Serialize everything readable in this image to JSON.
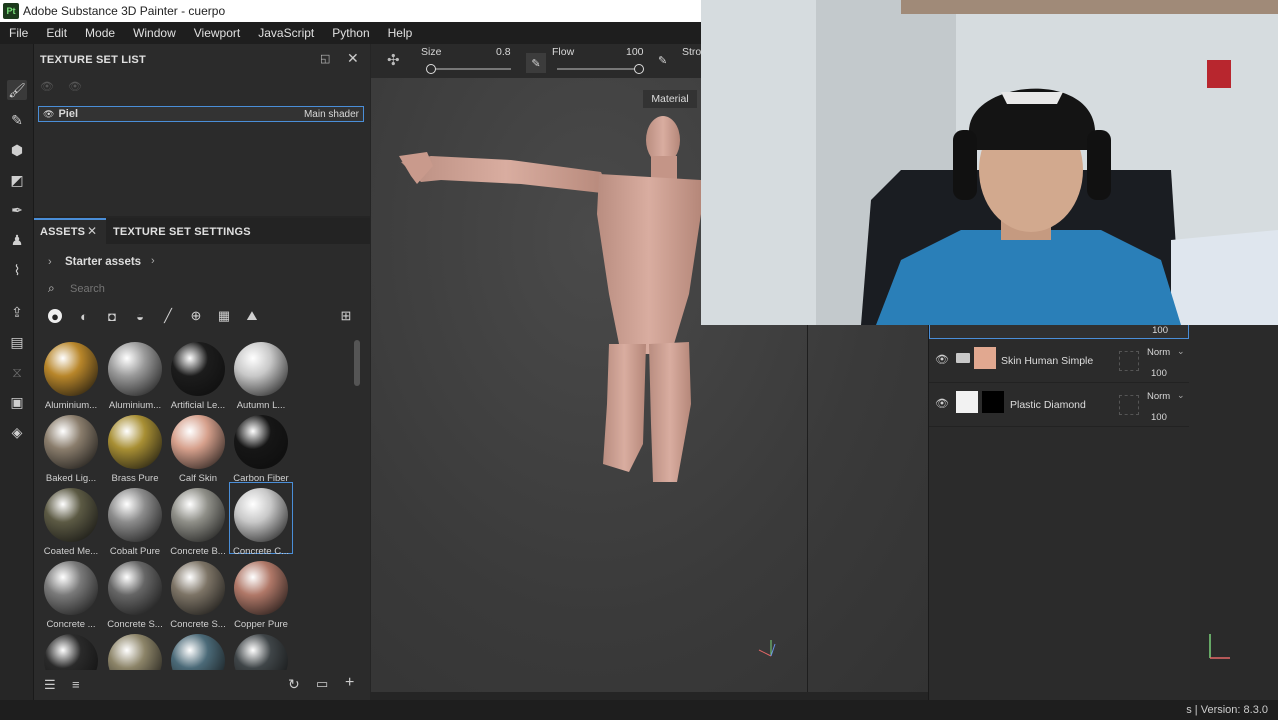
{
  "window": {
    "title": "Adobe Substance 3D Painter - cuerpo",
    "logo_text": "Pt"
  },
  "menu": [
    "File",
    "Edit",
    "Mode",
    "Window",
    "Viewport",
    "JavaScript",
    "Python",
    "Help"
  ],
  "texture_set_list": {
    "title": "TEXTURE SET LIST",
    "row": {
      "name": "Piel",
      "shader": "Main shader"
    }
  },
  "assets": {
    "tab_assets": "ASSETS",
    "tab_tss": "TEXTURE SET SETTINGS",
    "breadcrumb": "Starter assets",
    "search_placeholder": "Search",
    "materials": [
      {
        "label": "Aluminium...",
        "color": "#b8862a"
      },
      {
        "label": "Aluminium...",
        "color": "#9a9a9a"
      },
      {
        "label": "Artificial Le...",
        "color": "#1c1c1c"
      },
      {
        "label": "Autumn L...",
        "color": "#c8c8c8"
      },
      {
        "label": "Baked Lig...",
        "color": "#8a7d6c"
      },
      {
        "label": "Brass Pure",
        "color": "#a88f34"
      },
      {
        "label": "Calf Skin",
        "color": "#d6a08c"
      },
      {
        "label": "Carbon Fiber",
        "color": "#161616"
      },
      {
        "label": "Coated Me...",
        "color": "#5c5a44"
      },
      {
        "label": "Cobalt Pure",
        "color": "#8c8c8c"
      },
      {
        "label": "Concrete B...",
        "color": "#8f8f88"
      },
      {
        "label": "Concrete C...",
        "color": "#c8c8c8"
      },
      {
        "label": "Concrete ...",
        "color": "#7a7a7a"
      },
      {
        "label": "Concrete S...",
        "color": "#666666"
      },
      {
        "label": "Concrete S...",
        "color": "#7d7466"
      },
      {
        "label": "Copper Pure",
        "color": "#b07868"
      },
      {
        "label": "",
        "color": "#2a2a2a"
      },
      {
        "label": "",
        "color": "#8c8468"
      },
      {
        "label": "",
        "color": "#4b6a78"
      },
      {
        "label": "",
        "color": "#3f4548"
      }
    ]
  },
  "viewport": {
    "size_label": "Size",
    "size_value": "0.8",
    "flow_label": "Flow",
    "flow_value": "100",
    "stroke_label": "Stro",
    "material_badge": "Material",
    "size_fraction": 0.02,
    "flow_fraction": 1.0
  },
  "layers": {
    "top_value": "100",
    "items": [
      {
        "name": "Skin Human Simple",
        "blend": "Norm",
        "opacity": "100",
        "swatch": "#e1a890"
      },
      {
        "name": "Plastic Diamond",
        "blend": "Norm",
        "opacity": "100",
        "swatch": "#f2f2f2"
      }
    ]
  },
  "status": {
    "version": "s | Version: 8.3.0"
  }
}
